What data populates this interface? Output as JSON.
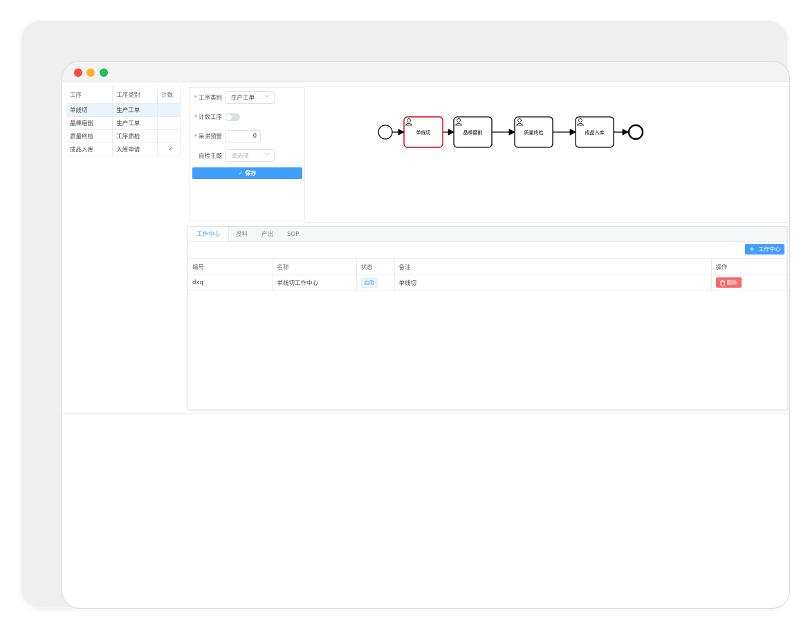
{
  "process_table": {
    "headers": [
      "工序",
      "工序类别",
      "计数"
    ],
    "rows": [
      {
        "name": "单线切",
        "category": "生产工单",
        "count": ""
      },
      {
        "name": "晶棒磨削",
        "category": "生产工单",
        "count": ""
      },
      {
        "name": "质量终检",
        "category": "工序质检",
        "count": ""
      },
      {
        "name": "成品入库",
        "category": "入库申请",
        "count": "✓"
      }
    ]
  },
  "form": {
    "category_label": "工序类别",
    "category_value": "生产工单",
    "count_label": "计数工序",
    "warning_label": "呆滞预警",
    "warning_value": "0",
    "inspect_label": "自检主题",
    "inspect_placeholder": "请选择",
    "required_mark": "*",
    "save_label": "保存",
    "save_icon": "✓"
  },
  "diagram": {
    "nodes": [
      "单线切",
      "晶棒磨削",
      "质量终检",
      "成品入库"
    ],
    "selected": "单线切",
    "colors": {
      "selected_border": "#d0021b",
      "node_border": "#000000"
    }
  },
  "tabs": [
    "工作中心",
    "投料",
    "产出",
    "SOP"
  ],
  "work_center": {
    "add_label": "工作中心",
    "add_icon": "+",
    "headers": [
      "编号",
      "名称",
      "状态",
      "备注",
      "操作"
    ],
    "rows": [
      {
        "code": "dxq",
        "name": "单线切工作中心",
        "status": "启用",
        "remark": "单线切",
        "action": "删除"
      }
    ]
  },
  "colors": {
    "accent": "#409eff",
    "danger": "#f56c6c"
  }
}
